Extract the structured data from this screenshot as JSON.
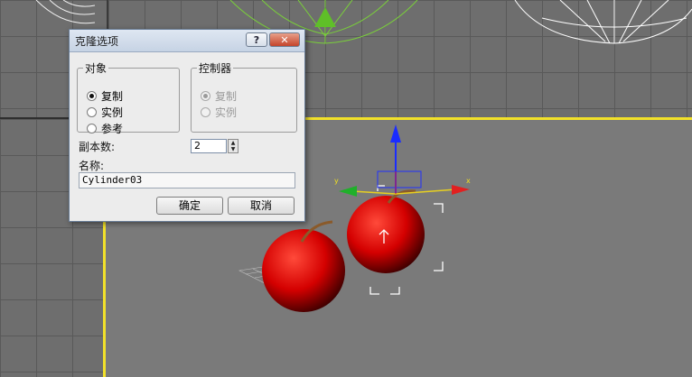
{
  "dialog": {
    "title": "克隆选项",
    "help_label": "?",
    "close_label": "✕",
    "object_group": {
      "legend": "对象",
      "options": [
        {
          "label": "复制",
          "selected": true
        },
        {
          "label": "实例",
          "selected": false
        },
        {
          "label": "参考",
          "selected": false
        }
      ]
    },
    "controller_group": {
      "legend": "控制器",
      "disabled": true,
      "options": [
        {
          "label": "复制",
          "selected": true
        },
        {
          "label": "实例",
          "selected": false
        }
      ]
    },
    "copies_label": "副本数:",
    "copies_value": "2",
    "name_label": "名称:",
    "name_value": "Cylinder03",
    "ok_label": "确定",
    "cancel_label": "取消"
  },
  "scene": {
    "axis_x_label": "x",
    "axis_y_label": "y",
    "active_viewport_border": "#f2e12a",
    "object_color": "#e01010",
    "annotation_arrow_color": "#e23a2a"
  }
}
